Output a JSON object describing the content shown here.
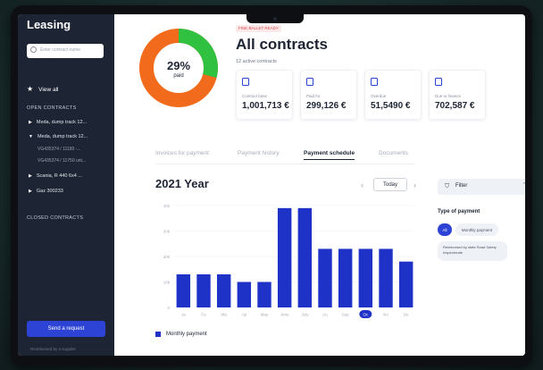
{
  "sidebar": {
    "brand": "Leasing",
    "search_placeholder": "Enter contract name",
    "view_all": "View all",
    "open_contracts_label": "OPEN CONTRACTS",
    "items": [
      {
        "label": "Meda, dump track 12..."
      },
      {
        "label": "Meda, dump track 12..."
      },
      {
        "label": "Scania, R 440 6x4 ..."
      },
      {
        "label": "Gaz 300233"
      }
    ],
    "sub_items": [
      {
        "label": "VG435374 / 11190 -..."
      },
      {
        "label": "VG435374 / 11750 unt..."
      }
    ],
    "closed_contracts_label": "CLOSED CONTRACTS",
    "send_request": "Send a request",
    "footer": "Reimbursed by a supplier"
  },
  "header": {
    "donut_percent": "29%",
    "donut_label": "paid",
    "donut_fraction": 0.29,
    "badge": "FINE BALLET READY",
    "title": "All contracts",
    "subtitle": "12 active contracts"
  },
  "cards": [
    {
      "label": "Contract base",
      "value": "1,001,713 €",
      "icon": "document-icon"
    },
    {
      "label": "Paid for",
      "value": "299,126 €",
      "icon": "document-icon"
    },
    {
      "label": "Overdue",
      "value": "51,5490 €",
      "icon": "document-icon"
    },
    {
      "label": "Due to finance",
      "value": "702,587 €",
      "icon": "document-icon"
    }
  ],
  "tabs": [
    {
      "label": "Invoices for payment",
      "active": false
    },
    {
      "label": "Payment history",
      "active": false
    },
    {
      "label": "Payment schedule",
      "active": true
    },
    {
      "label": "Documents",
      "active": false
    }
  ],
  "schedule": {
    "year_title": "2021 Year",
    "today_label": "Today",
    "prev_icon": "chevron-left-icon",
    "next_icon": "chevron-right-icon"
  },
  "filter": {
    "label": "Filter",
    "type_label": "Type of payment",
    "pill_all": "All",
    "pill_monthly": "Monthly payment",
    "pill_reimb": "Reimbursed by state Road Safety Inspectorate"
  },
  "colors": {
    "bar": "#1e32c8",
    "donut_green": "#2fc13f",
    "donut_orange": "#f26a1b",
    "accent": "#2d43d6",
    "sidebar": "#1d2433"
  },
  "chart_data": {
    "type": "bar",
    "categories": [
      "Ja",
      "Fe",
      "Ma",
      "Ap",
      "May",
      "June",
      "July",
      "Au",
      "Sep",
      "Oc",
      "No",
      "De"
    ],
    "values": [
      13,
      13,
      13,
      10,
      10,
      39,
      39,
      23,
      23,
      23,
      23,
      18
    ],
    "ylim": [
      0,
      40
    ],
    "yticks": [
      "0",
      "10k",
      "20k",
      "30k",
      "40k"
    ],
    "highlight_index": 9,
    "legend": "Monthly payment",
    "grid": true
  }
}
